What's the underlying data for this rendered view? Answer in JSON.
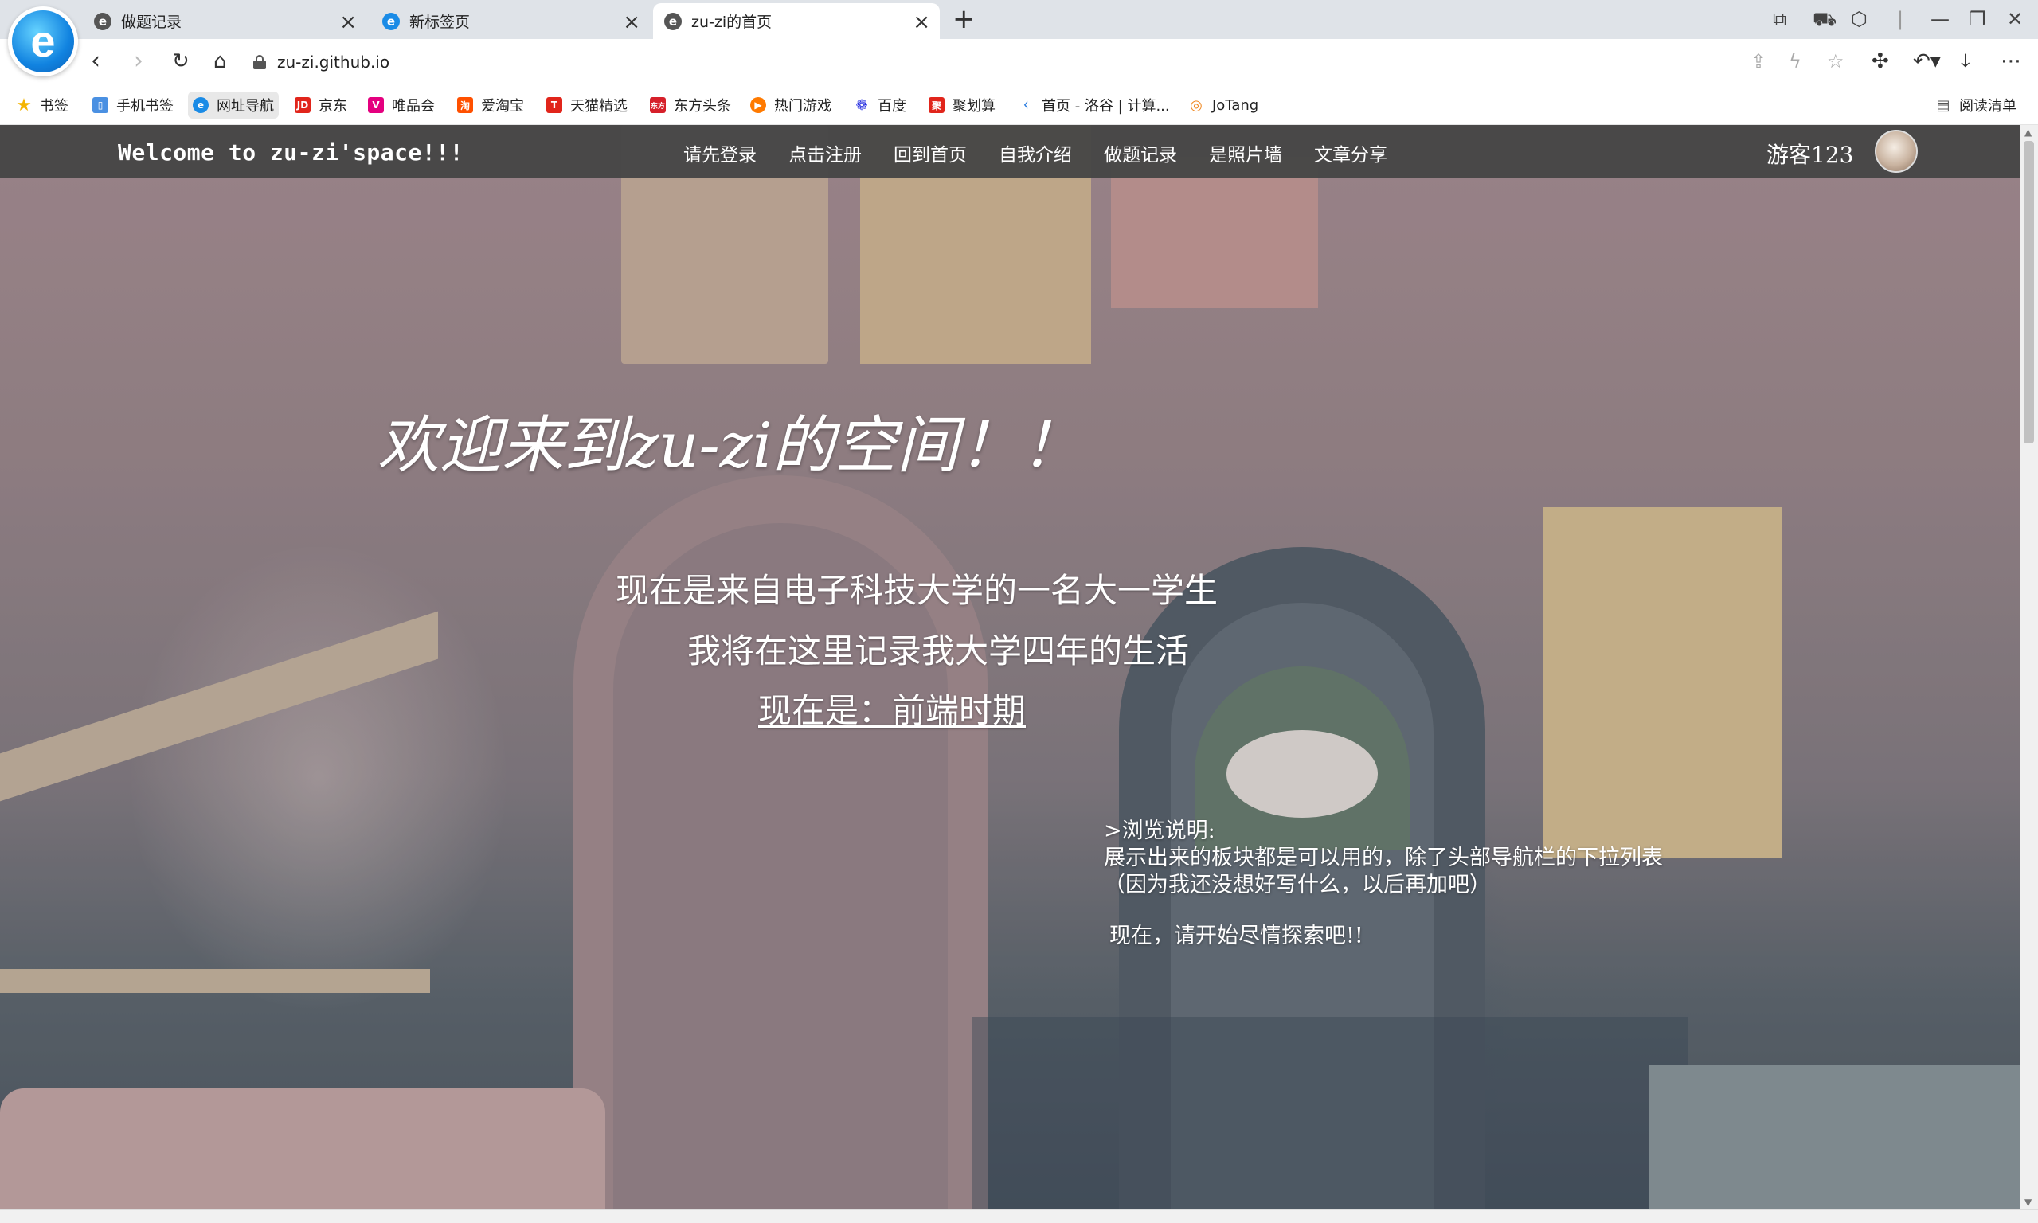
{
  "browser": {
    "tabs": [
      {
        "title": "做题记录"
      },
      {
        "title": "新标签页"
      },
      {
        "title": "zu-zi的首页"
      }
    ],
    "tab_close_glyph": "×",
    "url": "zu-zi.github.io",
    "bookmarks": [
      {
        "label": "书签",
        "icon": "star-icon",
        "color": "#f4b400"
      },
      {
        "label": "手机书签",
        "icon": "phone-icon",
        "color": "#4a90e2"
      },
      {
        "label": "网址导航",
        "icon": "browser-e-icon",
        "color": "#1a8be6"
      },
      {
        "label": "京东",
        "icon": "jd-icon",
        "color": "#e1251b"
      },
      {
        "label": "唯品会",
        "icon": "vip-icon",
        "color": "#e4007f"
      },
      {
        "label": "爱淘宝",
        "icon": "taobao-icon",
        "color": "#ff5000"
      },
      {
        "label": "天猫精选",
        "icon": "tmall-icon",
        "color": "#e1251b"
      },
      {
        "label": "东方头条",
        "icon": "news-icon",
        "color": "#d6202a"
      },
      {
        "label": "热门游戏",
        "icon": "game-icon",
        "color": "#ff7a00"
      },
      {
        "label": "百度",
        "icon": "baidu-paw-icon",
        "color": "#2932e1"
      },
      {
        "label": "聚划算",
        "icon": "juhuasuan-icon",
        "color": "#e1251b"
      },
      {
        "label": "首页 - 洛谷 | 计算...",
        "icon": "luogu-icon",
        "color": "#2f7fe0"
      },
      {
        "label": "JoTang",
        "icon": "jotang-icon",
        "color": "#f08a24"
      }
    ],
    "reading_list": "阅读清单"
  },
  "site": {
    "brand": "Welcome to zu-zi'space!!!",
    "nav": [
      "请先登录",
      "点击注册",
      "回到首页",
      "自我介绍",
      "做题记录",
      "是照片墙",
      "文章分享"
    ],
    "guest": "游客123"
  },
  "hero": {
    "title": "欢迎来到zu-zi的空间！！",
    "line1": "现在是来自电子科技大学的一名大一学生",
    "line2": "我将在这里记录我大学四年的生活",
    "link": "现在是：前端时期"
  },
  "notes": {
    "heading": ">浏览说明:",
    "body1": "展示出来的板块都是可以用的，除了头部导航栏的下拉列表",
    "body2": "（因为我还没想好写什么，以后再加吧）",
    "cta": "现在，请开始尽情探索吧!!"
  },
  "colors": {
    "header_bg": "#464646",
    "tab_bar_bg": "#dfe3e8",
    "text_on_dark": "#ffffff"
  }
}
